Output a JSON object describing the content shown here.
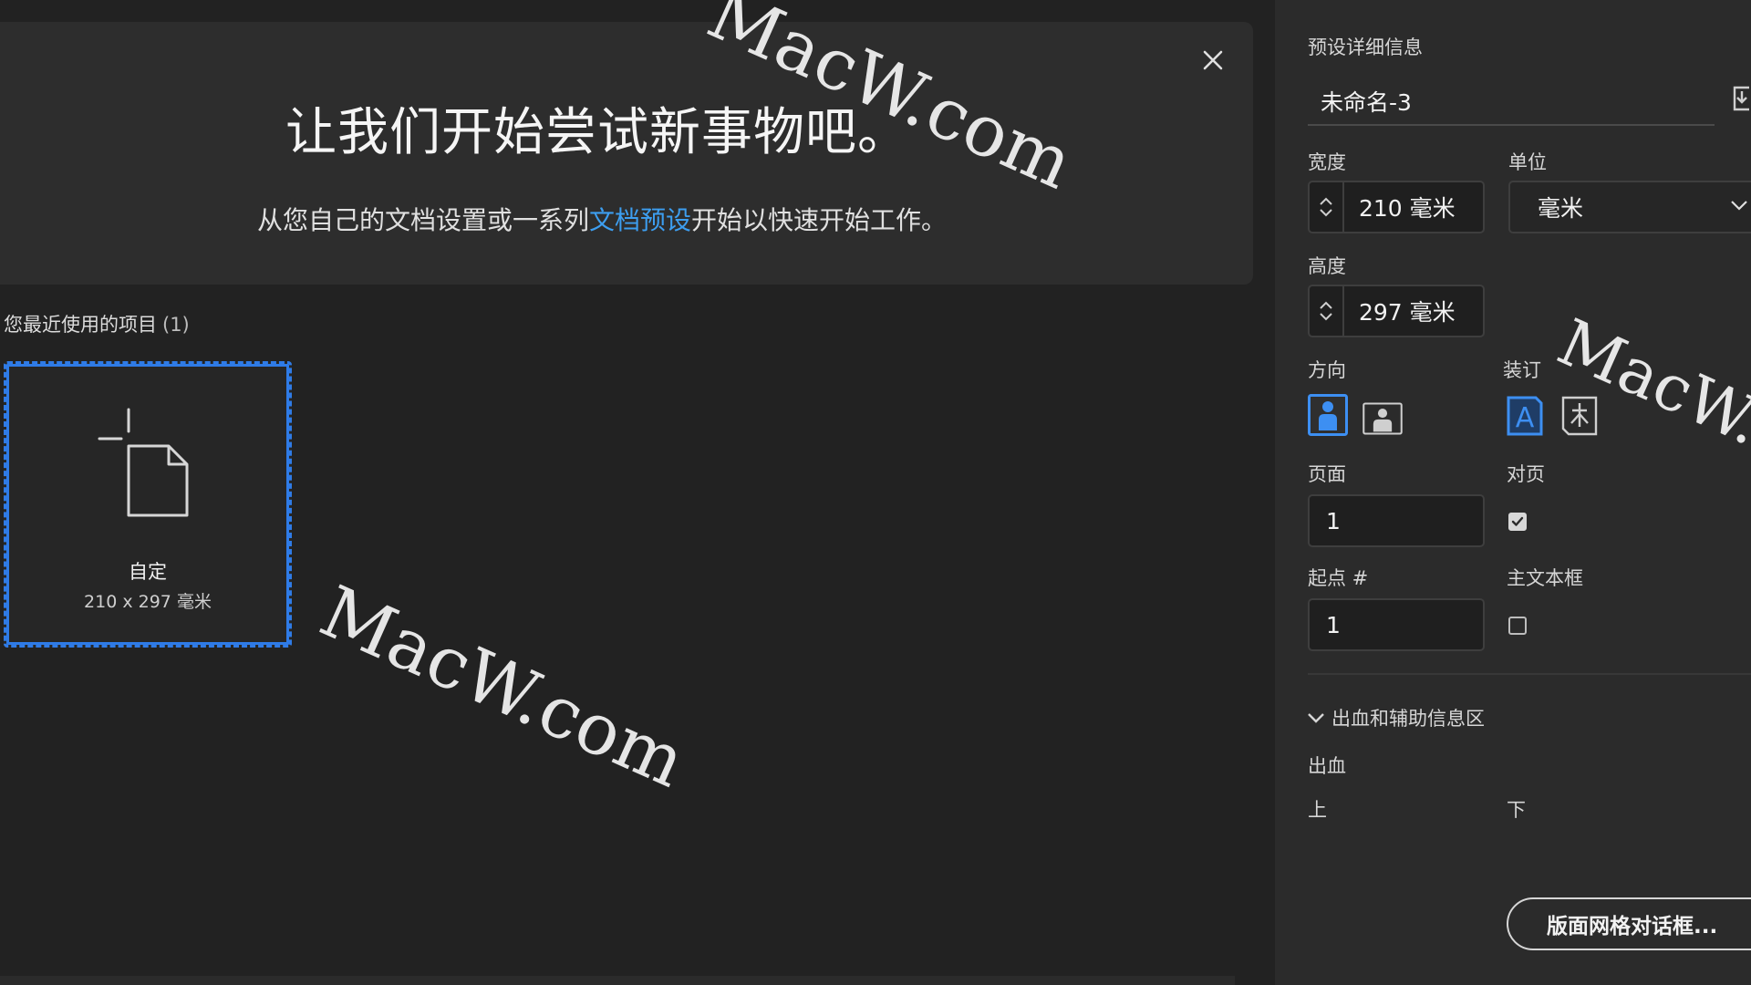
{
  "hero": {
    "title": "让我们开始尝试新事物吧。",
    "subtitle_before": "从您自己的文档设置或一系列",
    "subtitle_link": "文档预设",
    "subtitle_after": "开始以快速开始工作。"
  },
  "recent": {
    "heading": "您最近使用的项目",
    "count": "(1)",
    "items": [
      {
        "name": "自定",
        "size": "210 x 297 毫米"
      }
    ]
  },
  "watermark": "MacW.com",
  "panel": {
    "section_title": "预设详细信息",
    "doc_name": "未命名-3",
    "width_label": "宽度",
    "width_value": "210 毫米",
    "unit_label": "单位",
    "unit_value": "毫米",
    "height_label": "高度",
    "height_value": "297 毫米",
    "orientation_label": "方向",
    "binding_label": "装订",
    "pages_label": "页面",
    "pages_value": "1",
    "facing_label": "对页",
    "facing_checked": true,
    "start_label": "起点 #",
    "start_value": "1",
    "primary_frame_label": "主文本框",
    "primary_frame_checked": false,
    "bleed_section": "出血和辅助信息区",
    "bleed_label": "出血",
    "top_label": "上",
    "bottom_label": "下",
    "grid_button": "版面网格对话框..."
  },
  "colors": {
    "accent": "#2f7be6",
    "link": "#3d9ef0",
    "panel_bg": "#2b2b2b",
    "main_bg": "#222222"
  }
}
